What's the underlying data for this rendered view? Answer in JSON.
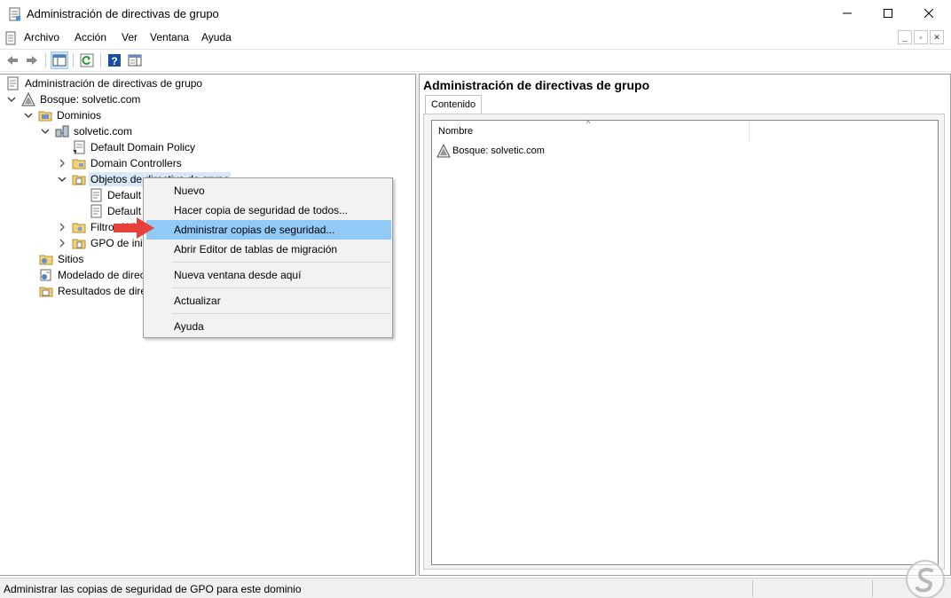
{
  "window": {
    "title": "Administración de directivas de grupo"
  },
  "menu": {
    "items": [
      "Archivo",
      "Acción",
      "Ver",
      "Ventana",
      "Ayuda"
    ]
  },
  "tree": {
    "root": "Administración de directivas de grupo",
    "forest": "Bosque: solvetic.com",
    "domains": "Dominios",
    "domain": "solvetic.com",
    "default_domain_policy": "Default Domain Policy",
    "domain_controllers": "Domain Controllers",
    "gpo_objects": "Objetos de directiva de grupo",
    "gpo_child_1": "Default Domain Controllers Policy",
    "gpo_child_2": "Default Domain Policy",
    "wmi_filters": "Filtros WMI",
    "starter_gpos": "GPO de inicio",
    "sites": "Sitios",
    "modeling": "Modelado de directivas de grupo",
    "results": "Resultados de directivas de grupo"
  },
  "context_menu": {
    "items": [
      "Nuevo",
      "Hacer copia de seguridad de todos...",
      "Administrar copias de seguridad...",
      "Abrir Editor de tablas de migración",
      "Nueva ventana desde aquí",
      "Actualizar",
      "Ayuda"
    ],
    "selected_index": 2
  },
  "right_pane": {
    "title": "Administración de directivas de grupo",
    "tab": "Contenido",
    "column_header": "Nombre",
    "rows": [
      "Bosque: solvetic.com"
    ]
  },
  "status": {
    "text": "Administrar las copias de seguridad de GPO para este dominio"
  },
  "colors": {
    "selected_menu": "#91c9f7",
    "highlight": "#d9e8f7",
    "arrow": "#e8413c"
  }
}
